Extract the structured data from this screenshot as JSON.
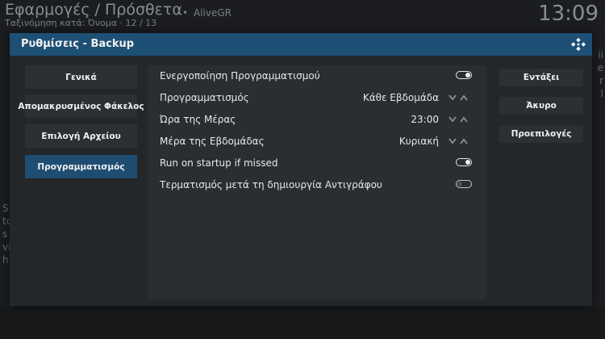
{
  "background": {
    "header_title": "Εφαρμογές / Πρόσθετα",
    "header_subtitle": "Ταξινόμηση κατά: Όνομα  ·  12 / 13",
    "list_item": "AliveGR",
    "clock": "13:09",
    "side_text": "S to s vi h",
    "right_text": "ii e r l"
  },
  "dialog": {
    "title": "Ρυθμίσεις - Backup",
    "categories": [
      {
        "label": "Γενικά"
      },
      {
        "label": "Απομακρυσμένος Φάκελος"
      },
      {
        "label": "Επιλογή Αρχείου"
      },
      {
        "label": "Προγραμματισμός",
        "active": true
      }
    ],
    "settings": [
      {
        "label": "Ενεργοποίηση Προγραμματισμού",
        "type": "toggle",
        "state": "on"
      },
      {
        "label": "Προγραμματισμός",
        "type": "spinner",
        "value": "Κάθε Εβδομάδα"
      },
      {
        "label": "Ώρα της Μέρας",
        "type": "spinner",
        "value": "23:00"
      },
      {
        "label": "Μέρα της Εβδομάδας",
        "type": "spinner",
        "value": "Κυριακή"
      },
      {
        "label": "Run on startup if missed",
        "type": "toggle",
        "state": "on"
      },
      {
        "label": "Τερματισμός μετά τη δημιουργία Αντιγράφου",
        "type": "toggle",
        "state": "off"
      }
    ],
    "buttons": {
      "ok": "Εντάξει",
      "cancel": "Άκυρο",
      "defaults": "Προεπιλογές"
    },
    "icons": {
      "close": "kodi-logo-icon",
      "spinner_down": "chevron-down-icon",
      "spinner_up": "chevron-up-icon"
    },
    "colors": {
      "titlebar": "#1e4f74",
      "active_category": "#1f4d72",
      "panel": "#2a2d31"
    }
  }
}
